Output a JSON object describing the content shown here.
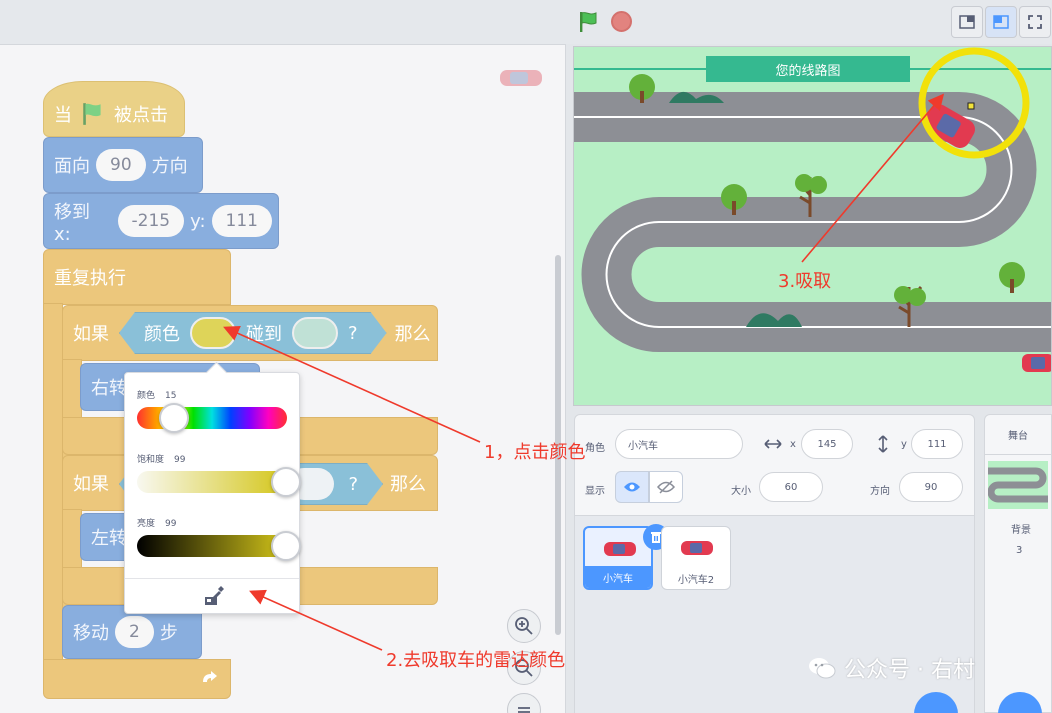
{
  "topbar": {
    "green_flag": "green-flag-icon",
    "stop": "stop-icon",
    "layout_buttons": [
      "small-stage-icon",
      "large-stage-icon",
      "fullscreen-icon"
    ]
  },
  "code": {
    "event_when": "当",
    "event_clicked": "被点击",
    "point_direction": {
      "prefix": "面向",
      "value": "90",
      "suffix": "方向"
    },
    "goto_xy": {
      "prefix": "移到 x:",
      "x": "-215",
      "ylabel": "y:",
      "y": "111"
    },
    "forever": "重复执行",
    "if1": {
      "if": "如果",
      "color": "颜色",
      "touching": "碰到",
      "q": "?",
      "then": "那么"
    },
    "turn_right": "右转",
    "if2": {
      "if": "如果",
      "q": "?",
      "then": "那么"
    },
    "turn_left": "左转",
    "move": {
      "prefix": "移动",
      "value": "2",
      "suffix": "步"
    }
  },
  "picker": {
    "hue_label": "颜色",
    "hue_value": "15",
    "sat_label": "饱和度",
    "sat_value": "99",
    "bright_label": "亮度",
    "bright_value": "99",
    "eyedropper": "eyedropper-icon",
    "hue_level": 0.15,
    "sat_level": 0.99,
    "bright_level": 0.99
  },
  "stage": {
    "title": "您的线路图"
  },
  "sprite_info": {
    "sprite_label": "角色",
    "sprite_name": "小汽车",
    "x_label": "x",
    "x_value": "145",
    "y_label": "y",
    "y_value": "111",
    "show_label": "显示",
    "size_label": "大小",
    "size_value": "60",
    "direction_label": "方向",
    "direction_value": "90"
  },
  "sprites": [
    {
      "name": "小汽车",
      "selected": true
    },
    {
      "name": "小汽车2",
      "selected": false
    }
  ],
  "stage_panel": {
    "header": "舞台",
    "backdrop_label": "背景",
    "backdrop_count": "3"
  },
  "annotations": {
    "step1": "1，点击颜色",
    "step2": "2.去吸取车的雷达颜色",
    "step3": "3.吸取"
  },
  "watermark": {
    "text": "公众号 · 右村"
  },
  "colors": {
    "event": "#e2c059",
    "motion": "#5c8fd2",
    "control": "#e5b24a",
    "sensing": "#5ea8c9",
    "picked_color": "#d2c41a",
    "annotation": "#ef3a2c",
    "stage_bg": "#b7efc5"
  }
}
